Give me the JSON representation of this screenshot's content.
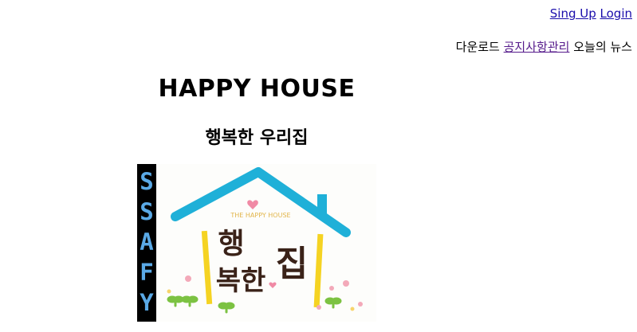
{
  "header": {
    "signup_label": "Sing Up",
    "login_label": "Login"
  },
  "nav": {
    "download_label": "다운로드",
    "notice_label": "공지사항관리",
    "news_label": "오늘의 뉴스"
  },
  "main": {
    "title": "HAPPY HOUSE",
    "subtitle": "행복한 우리집"
  },
  "banner": {
    "side_text": "SSAFY",
    "small_caption": "THE HAPPY HOUSE",
    "hand_text_1": "행",
    "hand_text_2": "복한",
    "hand_text_3": "집",
    "colors": {
      "side_bg": "#000000",
      "side_letters": "#5aa9e6",
      "roof": "#1fb0d8",
      "pillar": "#f5d322",
      "ink": "#3a2218",
      "sprout": "#7cc242",
      "flower": "#f3a9b9"
    }
  }
}
